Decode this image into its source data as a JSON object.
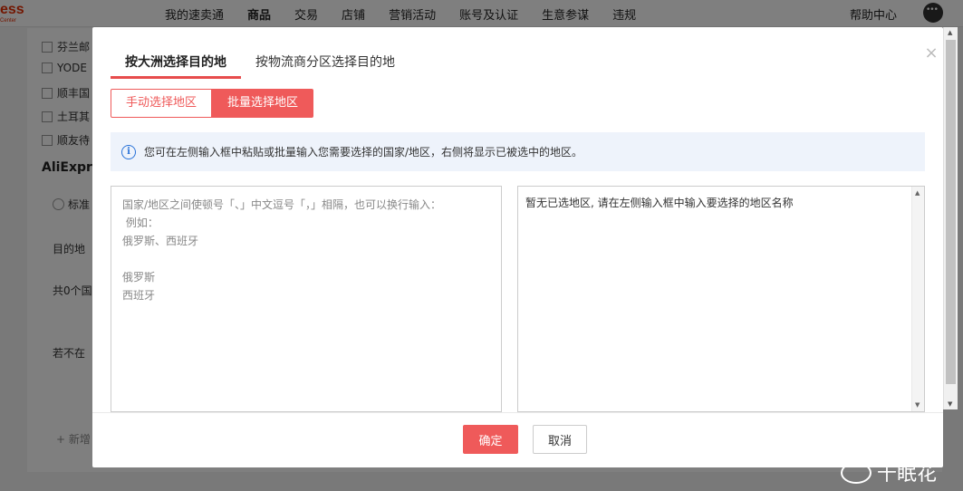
{
  "topbar": {
    "logo": "ess",
    "logo_sub": "Center",
    "nav": [
      "我的速卖通",
      "商品",
      "交易",
      "店铺",
      "营销活动",
      "账号及认证",
      "生意参谋",
      "违规"
    ],
    "help": "帮助中心"
  },
  "background": {
    "checkbox_items": [
      "芬兰邮",
      "YODE",
      "顺丰国",
      "土耳其",
      "顺友待"
    ],
    "heading": "AliExpre",
    "radio_label": "标准",
    "row_dest": "目的地",
    "row_count": "共0个国",
    "row_note": "若不在",
    "row_add": "+ 新增"
  },
  "modal": {
    "tabs": [
      {
        "label": "按大洲选择目的地",
        "active": true
      },
      {
        "label": "按物流商分区选择目的地",
        "active": false
      }
    ],
    "mode": {
      "manual": "手动选择地区",
      "batch": "批量选择地区"
    },
    "notice": "您可在左侧输入框中粘贴或批量输入您需要选择的国家/地区，右侧将显示已被选中的地区。",
    "input": {
      "value": "",
      "placeholder": "国家/地区之间使顿号「、」中文逗号「，」相隔，也可以换行输入：\n 例如：\n俄罗斯、西班牙\n\n俄罗斯\n西班牙"
    },
    "selected_empty": "暂无已选地区, 请在左侧输入框中输入要选择的地区名称",
    "confirm": "确定",
    "cancel": "取消"
  },
  "watermark": "千眠花",
  "colors": {
    "accent": "#ef5a5a",
    "info": "#2a73d8",
    "notice_bg": "#eef3fb"
  }
}
